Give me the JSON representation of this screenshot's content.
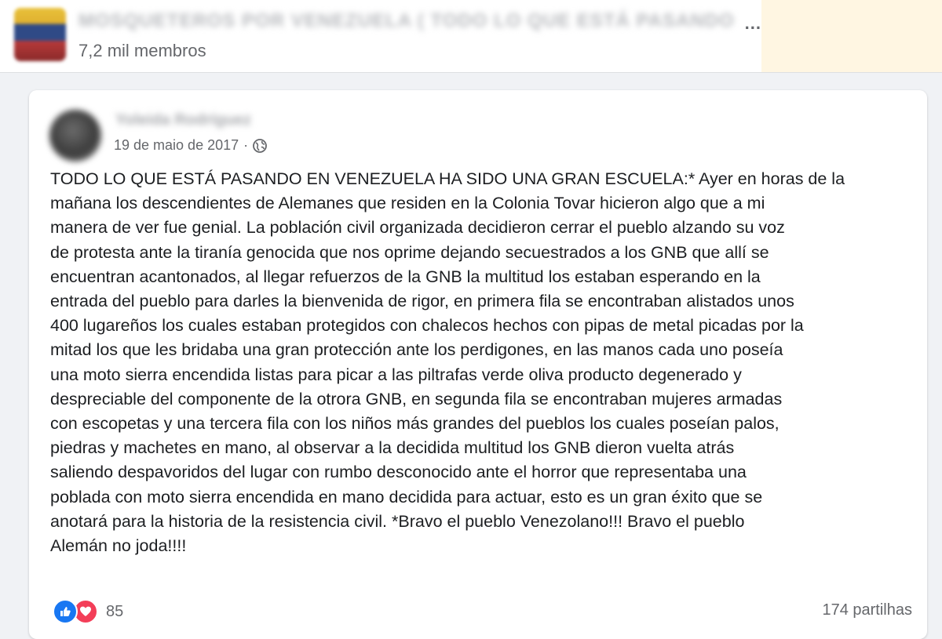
{
  "group": {
    "name": "MOSQUETEROS POR VENEZUELA ( TODO LO QUE ESTÁ PASANDO",
    "ellipsis": "...",
    "members": "7,2 mil membros"
  },
  "post": {
    "author": "Yoleida Rodríguez",
    "date": "19 de maio de 2017",
    "separator": "·",
    "privacy_icon": "globe-icon",
    "text": "TODO LO QUE ESTÁ PASANDO EN VENEZUELA HA SIDO UNA GRAN ESCUELA:* Ayer en horas de la\nmañana los descendientes de Alemanes que residen en la Colonia Tovar hicieron algo que a mi\nmanera de ver fue genial. La población civil organizada decidieron cerrar el pueblo alzando su voz\nde protesta ante la tiranía genocida que nos oprime dejando secuestrados a los GNB que allí se\nencuentran acantonados, al llegar refuerzos de la GNB la multitud los estaban esperando en la\nentrada del pueblo para darles la bienvenida de rigor, en primera fila se encontraban alistados unos\n400 lugareños los cuales estaban protegidos con chalecos hechos con pipas de metal picadas por la\nmitad los que les bridaba una gran protección ante los perdigones, en las manos cada uno poseía\nuna moto sierra encendida listas para picar a las piltrafas verde oliva producto degenerado y\ndespreciable del componente de la otrora GNB, en segunda fila se encontraban mujeres armadas\ncon escopetas y una tercera fila con los niños más grandes del pueblos los cuales poseían palos,\npiedras y machetes en mano, al observar a la decidida multitud los GNB dieron vuelta atrás\nsaliendo despavoridos del lugar con rumbo desconocido ante el horror que representaba una\npoblada con moto sierra encendida en mano decidida para actuar, esto es un gran éxito que se\nanotará para la historia de la resistencia civil. *Bravo el pueblo Venezolano!!! Bravo el pueblo\nAlemán no joda!!!!",
    "reaction_icons": [
      "like-icon",
      "love-icon"
    ],
    "reaction_count": "85",
    "shares": "174 partilhas"
  },
  "colors": {
    "like": "#1877f2",
    "love": "#f33e58",
    "secondary_text": "#65676b"
  }
}
